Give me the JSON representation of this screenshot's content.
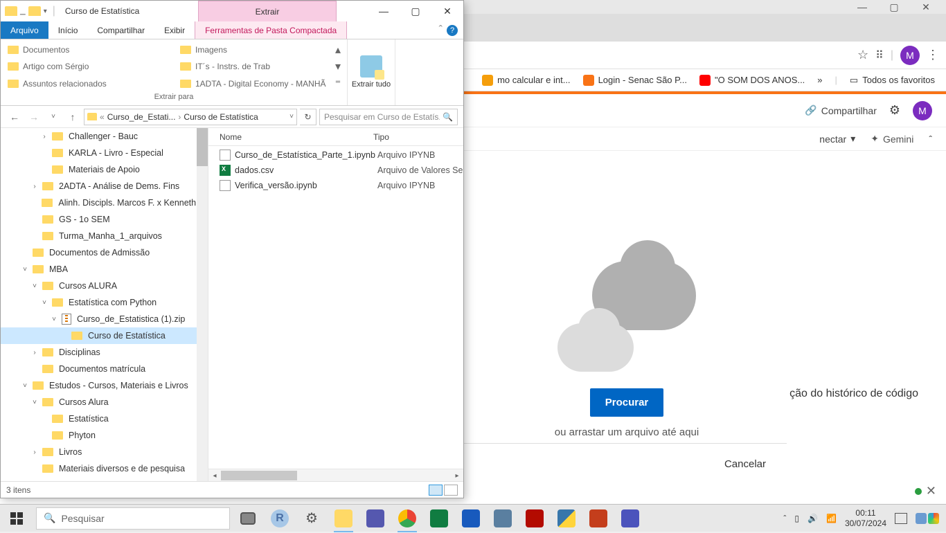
{
  "chrome": {
    "win_min": "—",
    "win_max": "▢",
    "win_close": "✕",
    "star": "☆",
    "ext": "⠿",
    "avatar": "M",
    "menu": "⋮",
    "bookmarks": [
      {
        "label": "mo calcular e int...",
        "color": "#f59e0b"
      },
      {
        "label": "Login - Senac São P...",
        "color": "#f97316"
      },
      {
        "label": "\"O SOM DOS ANOS...",
        "color": "#ff0000"
      }
    ],
    "more_bm": "»",
    "all_fav_icon": "▭",
    "all_fav": "Todos os favoritos",
    "share_icon": "🔗",
    "share": "Compartilhar",
    "gear": "⚙",
    "connect": "nectar",
    "connect_chev": "▾",
    "gemini_icon": "✦",
    "gemini": "Gemini",
    "sub_chev": "ˆ",
    "procurar": "Procurar",
    "drag_text": "ou arrastar um arquivo até aqui",
    "history": "ção do histórico de código",
    "cancelar": "Cancelar"
  },
  "explorer": {
    "titlebar": {
      "qat_down": "▾",
      "title": "Curso de Estatística",
      "context_tab": "Extrair",
      "min": "—",
      "max": "▢",
      "close": "✕"
    },
    "tabs": {
      "arquivo": "Arquivo",
      "inicio": "Início",
      "compartilhar": "Compartilhar",
      "exibir": "Exibir",
      "ferramentas": "Ferramentas de Pasta Compactada",
      "chev": "ˆ",
      "help": "?"
    },
    "ribbon": {
      "dests_left": [
        "Documentos",
        "Artigo com Sérgio",
        "Assuntos relacionados"
      ],
      "dests_right": [
        "Imagens",
        "IT´s - Instrs. de Trab",
        "1ADTA - Digital Economy - MANHÃ"
      ],
      "more_up": "▴",
      "more_down": "▾",
      "more_menu": "⁼",
      "panel_label": "Extrair para",
      "extract_all": "Extrair tudo"
    },
    "nav": {
      "back": "←",
      "fwd": "→",
      "recent": "˅",
      "up": "↑",
      "crumb1": "Curso_de_Estati...",
      "crumb2": "Curso de Estatística",
      "sep": "›",
      "addr_chev": "˅",
      "refresh": "↻",
      "search_placeholder": "Pesquisar em Curso de Estatís...",
      "search_icon": "🔍"
    },
    "tree": [
      {
        "indent": 4,
        "chev": "›",
        "icon": "folder",
        "label": "Challenger - Bauc"
      },
      {
        "indent": 4,
        "chev": "",
        "icon": "folder",
        "label": "KARLA - Livro - Especial"
      },
      {
        "indent": 4,
        "chev": "",
        "icon": "folder",
        "label": "Materiais de Apoio"
      },
      {
        "indent": 3,
        "chev": "›",
        "icon": "folder",
        "label": "2ADTA - Análise de Dems. Fins"
      },
      {
        "indent": 3,
        "chev": "",
        "icon": "folder",
        "label": "Alinh. Discipls. Marcos F. x Kenneth x"
      },
      {
        "indent": 3,
        "chev": "",
        "icon": "folder",
        "label": "GS - 1o SEM"
      },
      {
        "indent": 3,
        "chev": "",
        "icon": "folder",
        "label": "Turma_Manha_1_arquivos"
      },
      {
        "indent": 2,
        "chev": "",
        "icon": "folder",
        "label": "Documentos de Admissão"
      },
      {
        "indent": 2,
        "chev": "˅",
        "icon": "folder",
        "label": "MBA"
      },
      {
        "indent": 3,
        "chev": "˅",
        "icon": "folder",
        "label": "Cursos ALURA"
      },
      {
        "indent": 4,
        "chev": "˅",
        "icon": "folder",
        "label": "Estatística com Python"
      },
      {
        "indent": 5,
        "chev": "˅",
        "icon": "zip",
        "label": "Curso_de_Estatistica (1).zip"
      },
      {
        "indent": 6,
        "chev": "",
        "icon": "folder",
        "label": "Curso de Estatística",
        "selected": true
      },
      {
        "indent": 3,
        "chev": "›",
        "icon": "folder",
        "label": "Disciplinas"
      },
      {
        "indent": 3,
        "chev": "",
        "icon": "folder",
        "label": "Documentos matrícula"
      },
      {
        "indent": 2,
        "chev": "˅",
        "icon": "folder",
        "label": "Estudos - Cursos, Materiais e Livros"
      },
      {
        "indent": 3,
        "chev": "˅",
        "icon": "folder",
        "label": "Cursos Alura"
      },
      {
        "indent": 4,
        "chev": "",
        "icon": "folder",
        "label": "Estatística"
      },
      {
        "indent": 4,
        "chev": "",
        "icon": "folder",
        "label": "Phyton"
      },
      {
        "indent": 3,
        "chev": "›",
        "icon": "folder",
        "label": "Livros"
      },
      {
        "indent": 3,
        "chev": "",
        "icon": "folder",
        "label": "Materiais diversos e de pesquisa"
      }
    ],
    "columns": {
      "name": "Nome",
      "type": "Tipo"
    },
    "files": [
      {
        "icon": "ipynb",
        "name": "Curso_de_Estatística_Parte_1.ipynb",
        "type": "Arquivo IPYNB"
      },
      {
        "icon": "csv",
        "name": "dados.csv",
        "type": "Arquivo de Valores Se"
      },
      {
        "icon": "ipynb",
        "name": "Verifica_versão.ipynb",
        "type": "Arquivo IPYNB"
      }
    ],
    "status": "3 itens"
  },
  "taskbar": {
    "search_placeholder": "Pesquisar",
    "search_icon": "🔍",
    "tray_up": "ˆ",
    "battery": "▯",
    "vol": "🔊",
    "wifi": "📶",
    "time": "00:11",
    "date": "30/07/2024"
  }
}
